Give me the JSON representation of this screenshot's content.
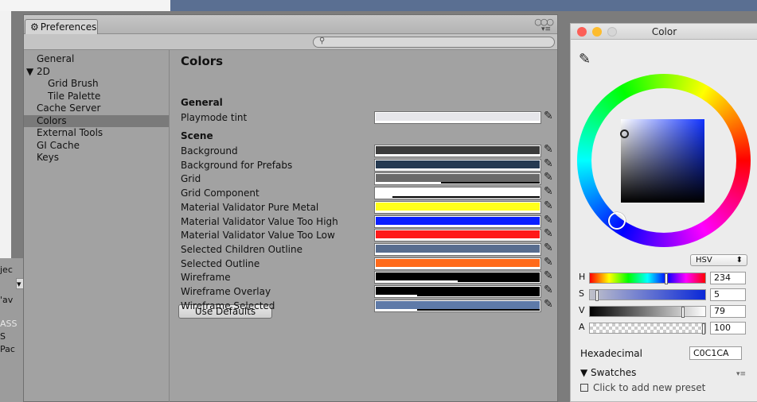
{
  "background": {
    "side_labels": [
      "jec",
      "▾",
      "'av",
      "ASS",
      "S",
      "Pac"
    ]
  },
  "prefs": {
    "tab_label": "Preferences",
    "sidebar": [
      {
        "label": "General",
        "indent": 0,
        "selected": false
      },
      {
        "label": "▼ 2D",
        "indent": 0,
        "selected": false
      },
      {
        "label": "Grid Brush",
        "indent": 2,
        "selected": false
      },
      {
        "label": "Tile Palette",
        "indent": 2,
        "selected": false
      },
      {
        "label": "Cache Server",
        "indent": 0,
        "selected": false
      },
      {
        "label": "Colors",
        "indent": 0,
        "selected": true
      },
      {
        "label": "External Tools",
        "indent": 0,
        "selected": false
      },
      {
        "label": "GI Cache",
        "indent": 0,
        "selected": false
      },
      {
        "label": "Keys",
        "indent": 0,
        "selected": false
      }
    ],
    "title": "Colors",
    "section_general": "General",
    "section_scene": "Scene",
    "general_items": [
      {
        "label": "Playmode tint",
        "color": "#e6e6ea",
        "alpha": 1.0
      }
    ],
    "scene_items": [
      {
        "label": "Background",
        "color": "#3b3b3b",
        "alpha": 1.0
      },
      {
        "label": "Background for Prefabs",
        "color": "#253a52",
        "alpha": 1.0
      },
      {
        "label": "Grid",
        "color": "#6a6a6a",
        "alpha": 0.4
      },
      {
        "label": "Grid Component",
        "color": "#ffffff",
        "alpha": 0.1
      },
      {
        "label": "Material Validator Pure Metal",
        "color": "#ffff1a",
        "alpha": 1.0
      },
      {
        "label": "Material Validator Value Too High",
        "color": "#0a1fff",
        "alpha": 1.0
      },
      {
        "label": "Material Validator Value Too Low",
        "color": "#ff1a1a",
        "alpha": 1.0
      },
      {
        "label": "Selected Children Outline",
        "color": "#586d8f",
        "alpha": 1.0
      },
      {
        "label": "Selected Outline",
        "color": "#ff6a1a",
        "alpha": 1.0
      },
      {
        "label": "Wireframe",
        "color": "#000000",
        "alpha": 0.5
      },
      {
        "label": "Wireframe Overlay",
        "color": "#000000",
        "alpha": 0.25
      },
      {
        "label": "Wireframe Selected",
        "color": "#5e7aa8",
        "alpha": 0.25
      }
    ],
    "use_defaults": "Use Defaults"
  },
  "picker": {
    "title": "Color",
    "mode": "HSV",
    "sliders": [
      {
        "label": "H",
        "value": "234",
        "fraction": 0.65
      },
      {
        "label": "S",
        "value": "5",
        "fraction": 0.05
      },
      {
        "label": "V",
        "value": "79",
        "fraction": 0.79
      },
      {
        "label": "A",
        "value": "100",
        "fraction": 1.0
      }
    ],
    "hex_label": "Hexadecimal",
    "hex_value": "C0C1CA",
    "swatches_label": "▼ Swatches",
    "preset_label": "Click to add new preset"
  }
}
